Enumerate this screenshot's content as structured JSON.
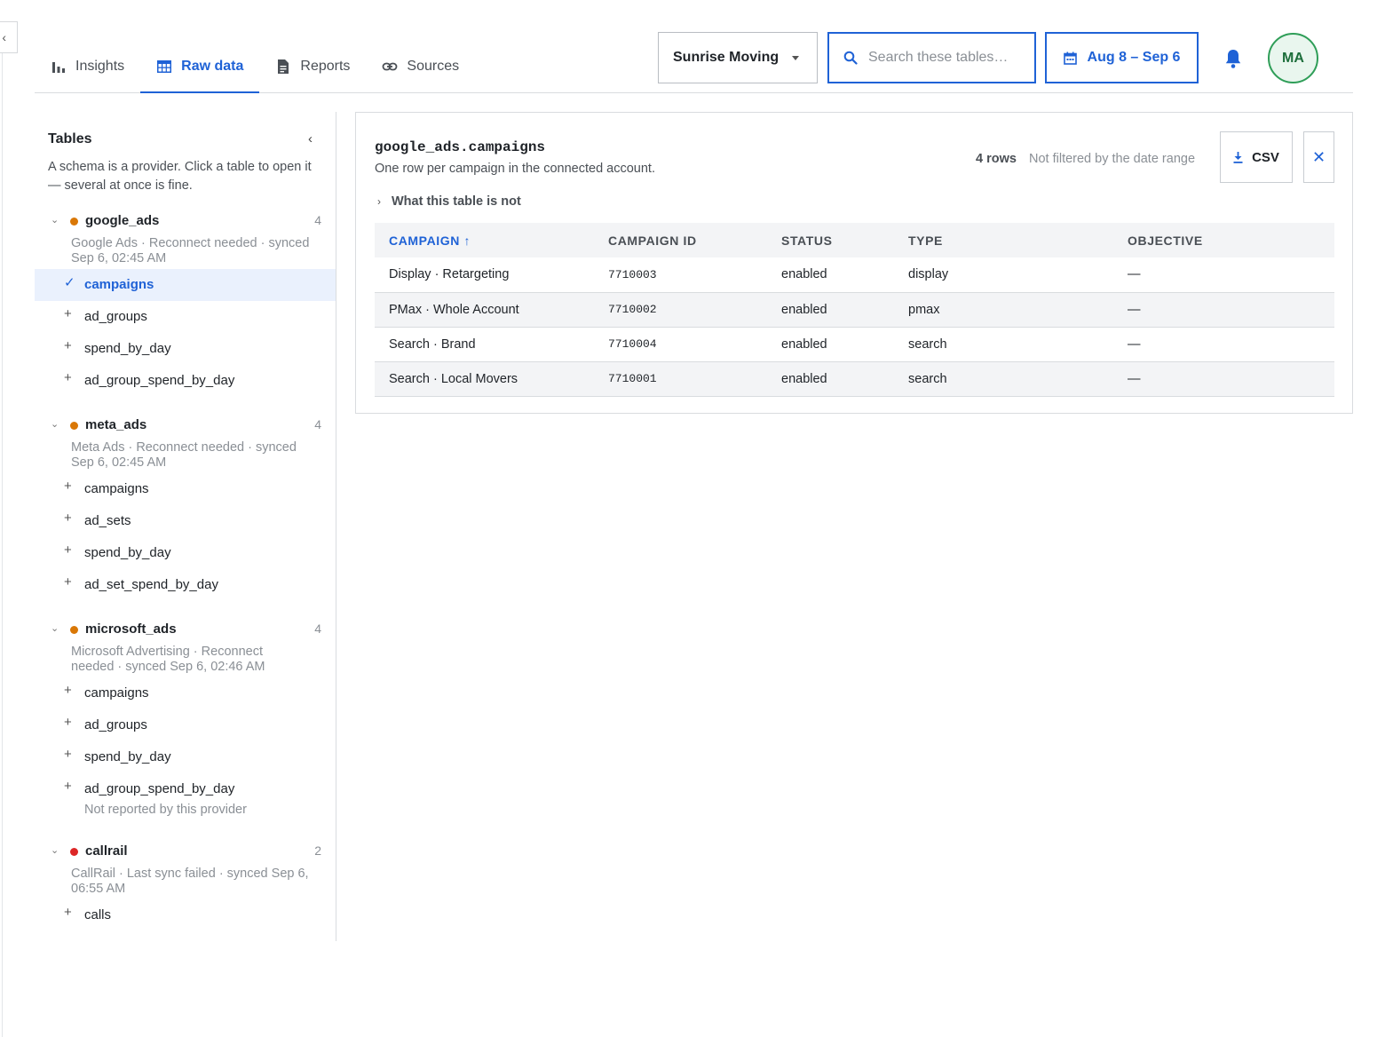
{
  "nav": {
    "tabs": [
      {
        "label": "Insights",
        "icon": "bar-chart-icon",
        "active": false
      },
      {
        "label": "Raw data",
        "icon": "table-icon",
        "active": true
      },
      {
        "label": "Reports",
        "icon": "document-icon",
        "active": false
      },
      {
        "label": "Sources",
        "icon": "link-icon",
        "active": false
      }
    ]
  },
  "header": {
    "account": "Sunrise Moving",
    "search_placeholder": "Search these tables…",
    "date_range": "Aug 8 – Sep 6",
    "avatar_initials": "MA"
  },
  "colors": {
    "accent": "#1f62d6",
    "status_warning": "#d97706",
    "status_error": "#dc2626",
    "avatar_ring": "#2f9e58"
  },
  "sidebar": {
    "title": "Tables",
    "description": "A schema is a provider. Click a table to open it — several at once is fine.",
    "providers": [
      {
        "name": "google_ads",
        "count": "4",
        "status": "warning",
        "meta_line1": "Google Ads · Reconnect needed · synced",
        "meta_line2": "Sep 6, 02:45 AM",
        "tables": [
          {
            "name": "campaigns",
            "selected": true
          },
          {
            "name": "ad_groups",
            "selected": false
          },
          {
            "name": "spend_by_day",
            "selected": false
          },
          {
            "name": "ad_group_spend_by_day",
            "selected": false
          }
        ]
      },
      {
        "name": "meta_ads",
        "count": "4",
        "status": "warning",
        "meta_line1": "Meta Ads · Reconnect needed · synced",
        "meta_line2": "Sep 6, 02:45 AM",
        "tables": [
          {
            "name": "campaigns"
          },
          {
            "name": "ad_sets"
          },
          {
            "name": "spend_by_day"
          },
          {
            "name": "ad_set_spend_by_day"
          }
        ]
      },
      {
        "name": "microsoft_ads",
        "count": "4",
        "status": "warning",
        "meta_line1": "Microsoft Advertising · Reconnect",
        "meta_line2": "needed · synced Sep 6, 02:46 AM",
        "tables": [
          {
            "name": "campaigns"
          },
          {
            "name": "ad_groups"
          },
          {
            "name": "spend_by_day"
          },
          {
            "name": "ad_group_spend_by_day",
            "note": "Not reported by this provider"
          }
        ]
      },
      {
        "name": "callrail",
        "count": "2",
        "status": "error",
        "meta_line1": "CallRail · Last sync failed · synced Sep 6,",
        "meta_line2": "06:55 AM",
        "tables": [
          {
            "name": "calls"
          }
        ]
      }
    ]
  },
  "panel": {
    "title": "google_ads.campaigns",
    "description": "One row per campaign in the connected account.",
    "row_count": "4 rows",
    "filter_note": "Not filtered by the date range",
    "csv_label": "CSV",
    "disclosure": "What this table is not",
    "columns": [
      "Campaign",
      "Campaign ID",
      "Status",
      "Type",
      "Objective"
    ],
    "sort_indicator": "↑",
    "rows": [
      [
        "Display · Retargeting",
        "7710003",
        "enabled",
        "display",
        "—"
      ],
      [
        "PMax · Whole Account",
        "7710002",
        "enabled",
        "pmax",
        "—"
      ],
      [
        "Search · Brand",
        "7710004",
        "enabled",
        "search",
        "—"
      ],
      [
        "Search · Local Movers",
        "7710001",
        "enabled",
        "search",
        "—"
      ]
    ]
  }
}
